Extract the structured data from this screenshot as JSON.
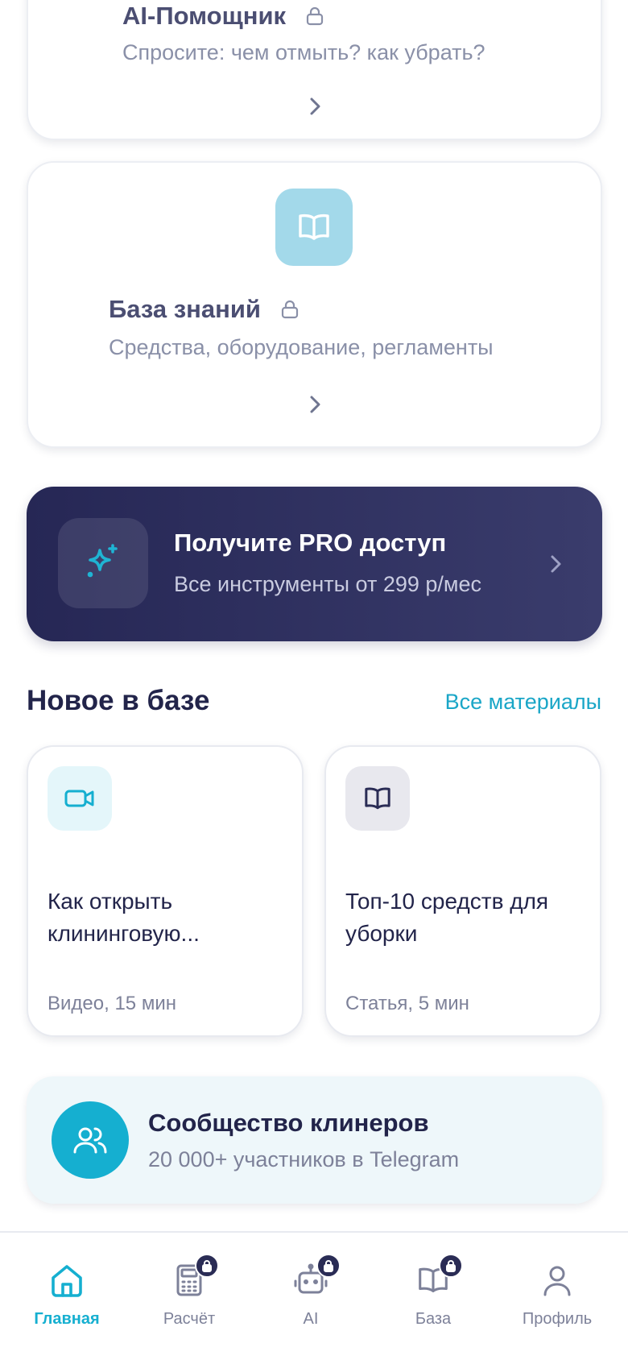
{
  "ai_card": {
    "title": "AI-Помощник",
    "description": "Спросите: чем отмыть? как убрать?",
    "icon": "lock-icon"
  },
  "kb_card": {
    "title": "База знаний",
    "description": "Средства, оборудование, регламенты",
    "icon": "book-icon"
  },
  "pro_banner": {
    "title": "Получите PRO доступ",
    "subtitle": "Все инструменты от 299 р/мес",
    "icon": "sparkles-icon"
  },
  "section": {
    "title": "Новое в базе",
    "link": "Все материалы"
  },
  "materials": [
    {
      "title": "Как открыть клининговую...",
      "meta": "Видео, 15 мин",
      "icon": "video-icon"
    },
    {
      "title": "Топ-10 средств для уборки",
      "meta": "Статья, 5 мин",
      "icon": "book-icon"
    }
  ],
  "community": {
    "title": "Сообщество клинеров",
    "subtitle": "20 000+ участников в Telegram",
    "icon": "users-icon"
  },
  "tabbar": {
    "items": [
      {
        "label": "Главная",
        "icon": "home-icon",
        "active": true,
        "locked": false
      },
      {
        "label": "Расчёт",
        "icon": "calculator-icon",
        "active": false,
        "locked": true
      },
      {
        "label": "AI",
        "icon": "robot-icon",
        "active": false,
        "locked": true
      },
      {
        "label": "База",
        "icon": "book-icon",
        "active": false,
        "locked": true
      },
      {
        "label": "Профиль",
        "icon": "user-icon",
        "active": false,
        "locked": false
      }
    ]
  },
  "colors": {
    "accent": "#15afd0",
    "dark_banner": "#262755",
    "text_primary": "#22244a",
    "text_muted": "#7d8199"
  }
}
